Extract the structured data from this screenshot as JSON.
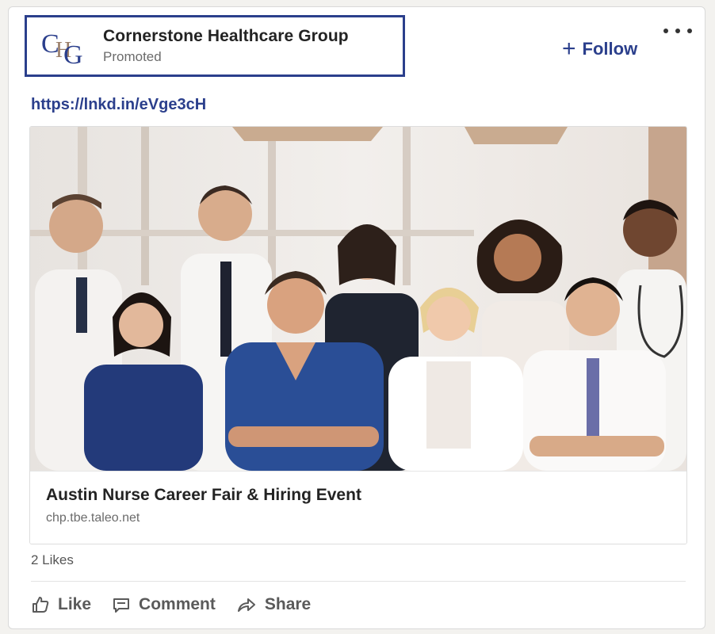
{
  "post": {
    "company_name": "Cornerstone Healthcare Group",
    "promoted_label": "Promoted",
    "logo_text": "CHG",
    "follow_label": "Follow",
    "link_text": "https://lnkd.in/eVge3cH"
  },
  "media": {
    "title": "Austin Nurse Career Fair & Hiring Event",
    "domain": "chp.tbe.taleo.net"
  },
  "social": {
    "likes": "2 Likes"
  },
  "actions": {
    "like": "Like",
    "comment": "Comment",
    "share": "Share"
  },
  "icons": {
    "follow": "plus-icon",
    "more": "more-options-icon",
    "like": "thumbs-up-icon",
    "comment": "comment-icon",
    "share": "share-arrow-icon"
  },
  "colors": {
    "brand": "#2b3f8c",
    "logo_accent": "#9b7f6a"
  }
}
